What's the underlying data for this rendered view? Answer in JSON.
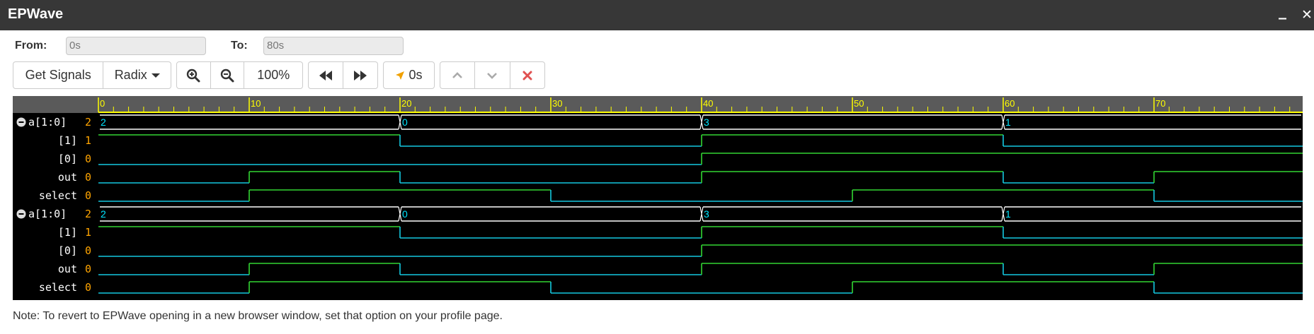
{
  "window": {
    "title": "EPWave",
    "minimize_glyph": "_",
    "close_glyph": "✕"
  },
  "range": {
    "from_label": "From:",
    "from_value": "0s",
    "to_label": "To:",
    "to_value": "80s"
  },
  "toolbar": {
    "get_signals": "Get Signals",
    "radix": "Radix",
    "zoom_level": "100%",
    "cursor_time": "0s",
    "icons": {
      "zoom_in": "zoom-in-icon",
      "zoom_out": "zoom-out-icon",
      "prev": "rewind-icon",
      "next": "fast-forward-icon",
      "cursor": "cursor-arrow-icon",
      "up": "chevron-up-icon",
      "down": "chevron-down-icon",
      "remove": "close-icon"
    }
  },
  "timeline": {
    "start": 0,
    "end": 80,
    "major_step": 10,
    "labels": [
      "0",
      "10",
      "20",
      "30",
      "40",
      "50",
      "60",
      "70"
    ]
  },
  "groups": [
    {
      "signals": [
        {
          "name": "a[1:0]",
          "value": "2",
          "bus": true,
          "expand_icon": "minus-circle-icon",
          "segments": [
            {
              "t": 0,
              "v": "2"
            },
            {
              "t": 20,
              "v": "0"
            },
            {
              "t": 40,
              "v": "3"
            },
            {
              "t": 60,
              "v": "1"
            }
          ]
        },
        {
          "name": "[1]",
          "value": "1",
          "bus": false,
          "changes": [
            {
              "t": 0,
              "v": 1
            },
            {
              "t": 20,
              "v": 0
            },
            {
              "t": 40,
              "v": 1
            },
            {
              "t": 60,
              "v": 0
            }
          ]
        },
        {
          "name": "[0]",
          "value": "0",
          "bus": false,
          "changes": [
            {
              "t": 0,
              "v": 0
            },
            {
              "t": 40,
              "v": 1
            }
          ]
        },
        {
          "name": "out",
          "value": "0",
          "bus": false,
          "changes": [
            {
              "t": 0,
              "v": 0
            },
            {
              "t": 10,
              "v": 1
            },
            {
              "t": 20,
              "v": 0
            },
            {
              "t": 40,
              "v": 1
            },
            {
              "t": 60,
              "v": 0
            },
            {
              "t": 70,
              "v": 1
            }
          ]
        },
        {
          "name": "select",
          "value": "0",
          "bus": false,
          "changes": [
            {
              "t": 0,
              "v": 0
            },
            {
              "t": 10,
              "v": 1
            },
            {
              "t": 30,
              "v": 0
            },
            {
              "t": 50,
              "v": 1
            },
            {
              "t": 70,
              "v": 0
            }
          ]
        }
      ]
    },
    {
      "signals": [
        {
          "name": "a[1:0]",
          "value": "2",
          "bus": true,
          "expand_icon": "minus-circle-icon",
          "segments": [
            {
              "t": 0,
              "v": "2"
            },
            {
              "t": 20,
              "v": "0"
            },
            {
              "t": 40,
              "v": "3"
            },
            {
              "t": 60,
              "v": "1"
            }
          ]
        },
        {
          "name": "[1]",
          "value": "1",
          "bus": false,
          "changes": [
            {
              "t": 0,
              "v": 1
            },
            {
              "t": 20,
              "v": 0
            },
            {
              "t": 40,
              "v": 1
            },
            {
              "t": 60,
              "v": 0
            }
          ]
        },
        {
          "name": "[0]",
          "value": "0",
          "bus": false,
          "changes": [
            {
              "t": 0,
              "v": 0
            },
            {
              "t": 40,
              "v": 1
            }
          ]
        },
        {
          "name": "out",
          "value": "0",
          "bus": false,
          "changes": [
            {
              "t": 0,
              "v": 0
            },
            {
              "t": 10,
              "v": 1
            },
            {
              "t": 20,
              "v": 0
            },
            {
              "t": 40,
              "v": 1
            },
            {
              "t": 60,
              "v": 0
            },
            {
              "t": 70,
              "v": 1
            }
          ]
        },
        {
          "name": "select",
          "value": "0",
          "bus": false,
          "changes": [
            {
              "t": 0,
              "v": 0
            },
            {
              "t": 10,
              "v": 1
            },
            {
              "t": 30,
              "v": 0
            },
            {
              "t": 50,
              "v": 1
            },
            {
              "t": 70,
              "v": 0
            }
          ]
        }
      ]
    }
  ],
  "colors": {
    "background": "#000000",
    "ruler": "#5a5a5a",
    "tick": "#ffff00",
    "bus_text": "#00e5ff",
    "bus_line": "#ffffff",
    "signal_high": "#33d633",
    "signal_low": "#14c8e0",
    "signal_name": "#ffffff",
    "signal_value": "#ffa500"
  },
  "note": "Note: To revert to EPWave opening in a new browser window, set that option on your profile page."
}
